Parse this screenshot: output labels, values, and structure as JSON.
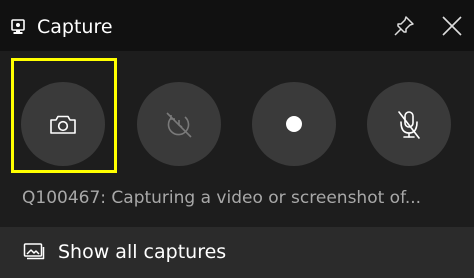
{
  "window": {
    "title": "Capture",
    "title_icon": "webcam-icon",
    "pin_icon": "pin-icon",
    "close_icon": "close-icon"
  },
  "capture_buttons": [
    {
      "name": "take-screenshot",
      "icon": "camera-icon",
      "focused": true
    },
    {
      "name": "record-last-30s",
      "icon": "record-last-disabled-icon",
      "disabled": true
    },
    {
      "name": "start-recording",
      "icon": "record-dot-icon"
    },
    {
      "name": "mic-toggle",
      "icon": "mic-off-icon"
    }
  ],
  "status_text": "Q100467: Capturing a video or screenshot of...",
  "footer": {
    "label": "Show all captures",
    "icon": "gallery-icon"
  },
  "colors": {
    "focus_ring": "#ffff00",
    "button_fill": "#3a3a3a",
    "panel_bg": "#1d1d1d",
    "titlebar_bg": "#111111",
    "footer_bg": "#2b2b2b",
    "status_text": "#a8a8a8"
  }
}
